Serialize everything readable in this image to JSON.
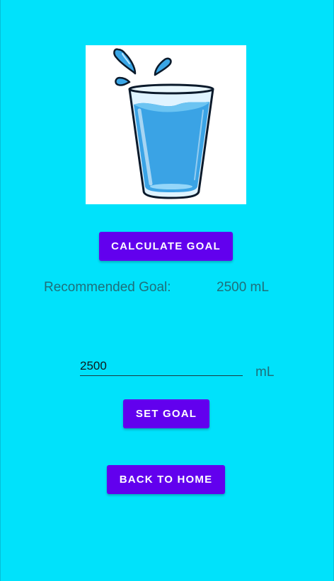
{
  "app": {
    "background_color": "#00e2fb",
    "accent_color": "#6200ee"
  },
  "hero": {
    "icon": "water-glass-icon"
  },
  "calculate": {
    "button_label": "CALCULATE GOAL"
  },
  "recommended": {
    "label": "Recommended Goal:",
    "value": "2500 mL"
  },
  "goal_input": {
    "value": "2500",
    "unit": "mL"
  },
  "set_goal": {
    "button_label": "SET GOAL"
  },
  "back_home": {
    "button_label": "BACK TO HOME"
  }
}
